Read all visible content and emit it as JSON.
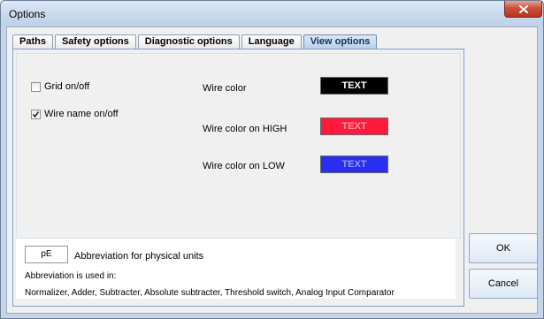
{
  "window": {
    "title": "Options"
  },
  "tabs": [
    "Paths",
    "Safety options",
    "Diagnostic options",
    "Language",
    "View options"
  ],
  "active_tab": "View options",
  "view_options": {
    "grid_label": "Grid on/off",
    "grid_checked": false,
    "wire_name_label": "Wire name on/off",
    "wire_name_checked": true,
    "wire_color_label": "Wire color",
    "wire_color_text": "TEXT",
    "wire_color_bg": "#000000",
    "wire_color_fg": "#ffffff",
    "wire_high_label": "Wire color on HIGH",
    "wire_high_text": "TEXT",
    "wire_high_bg": "#ff1a3d",
    "wire_high_fg": "#ff9aa0",
    "wire_low_label": "Wire color on LOW",
    "wire_low_text": "TEXT",
    "wire_low_bg": "#2a2ef0",
    "wire_low_fg": "#8fa0f5"
  },
  "abbreviation": {
    "value": "pE",
    "label": "Abbreviation for physical units",
    "used_in_label": "Abbreviation is used in:",
    "used_in_list": "Normalizer, Adder, Subtracter, Absolute subtracter, Threshold switch, Analog Input Comparator"
  },
  "buttons": {
    "ok": "OK",
    "cancel": "Cancel"
  },
  "icons": {
    "close": "close-icon",
    "check": "checkmark-icon"
  }
}
